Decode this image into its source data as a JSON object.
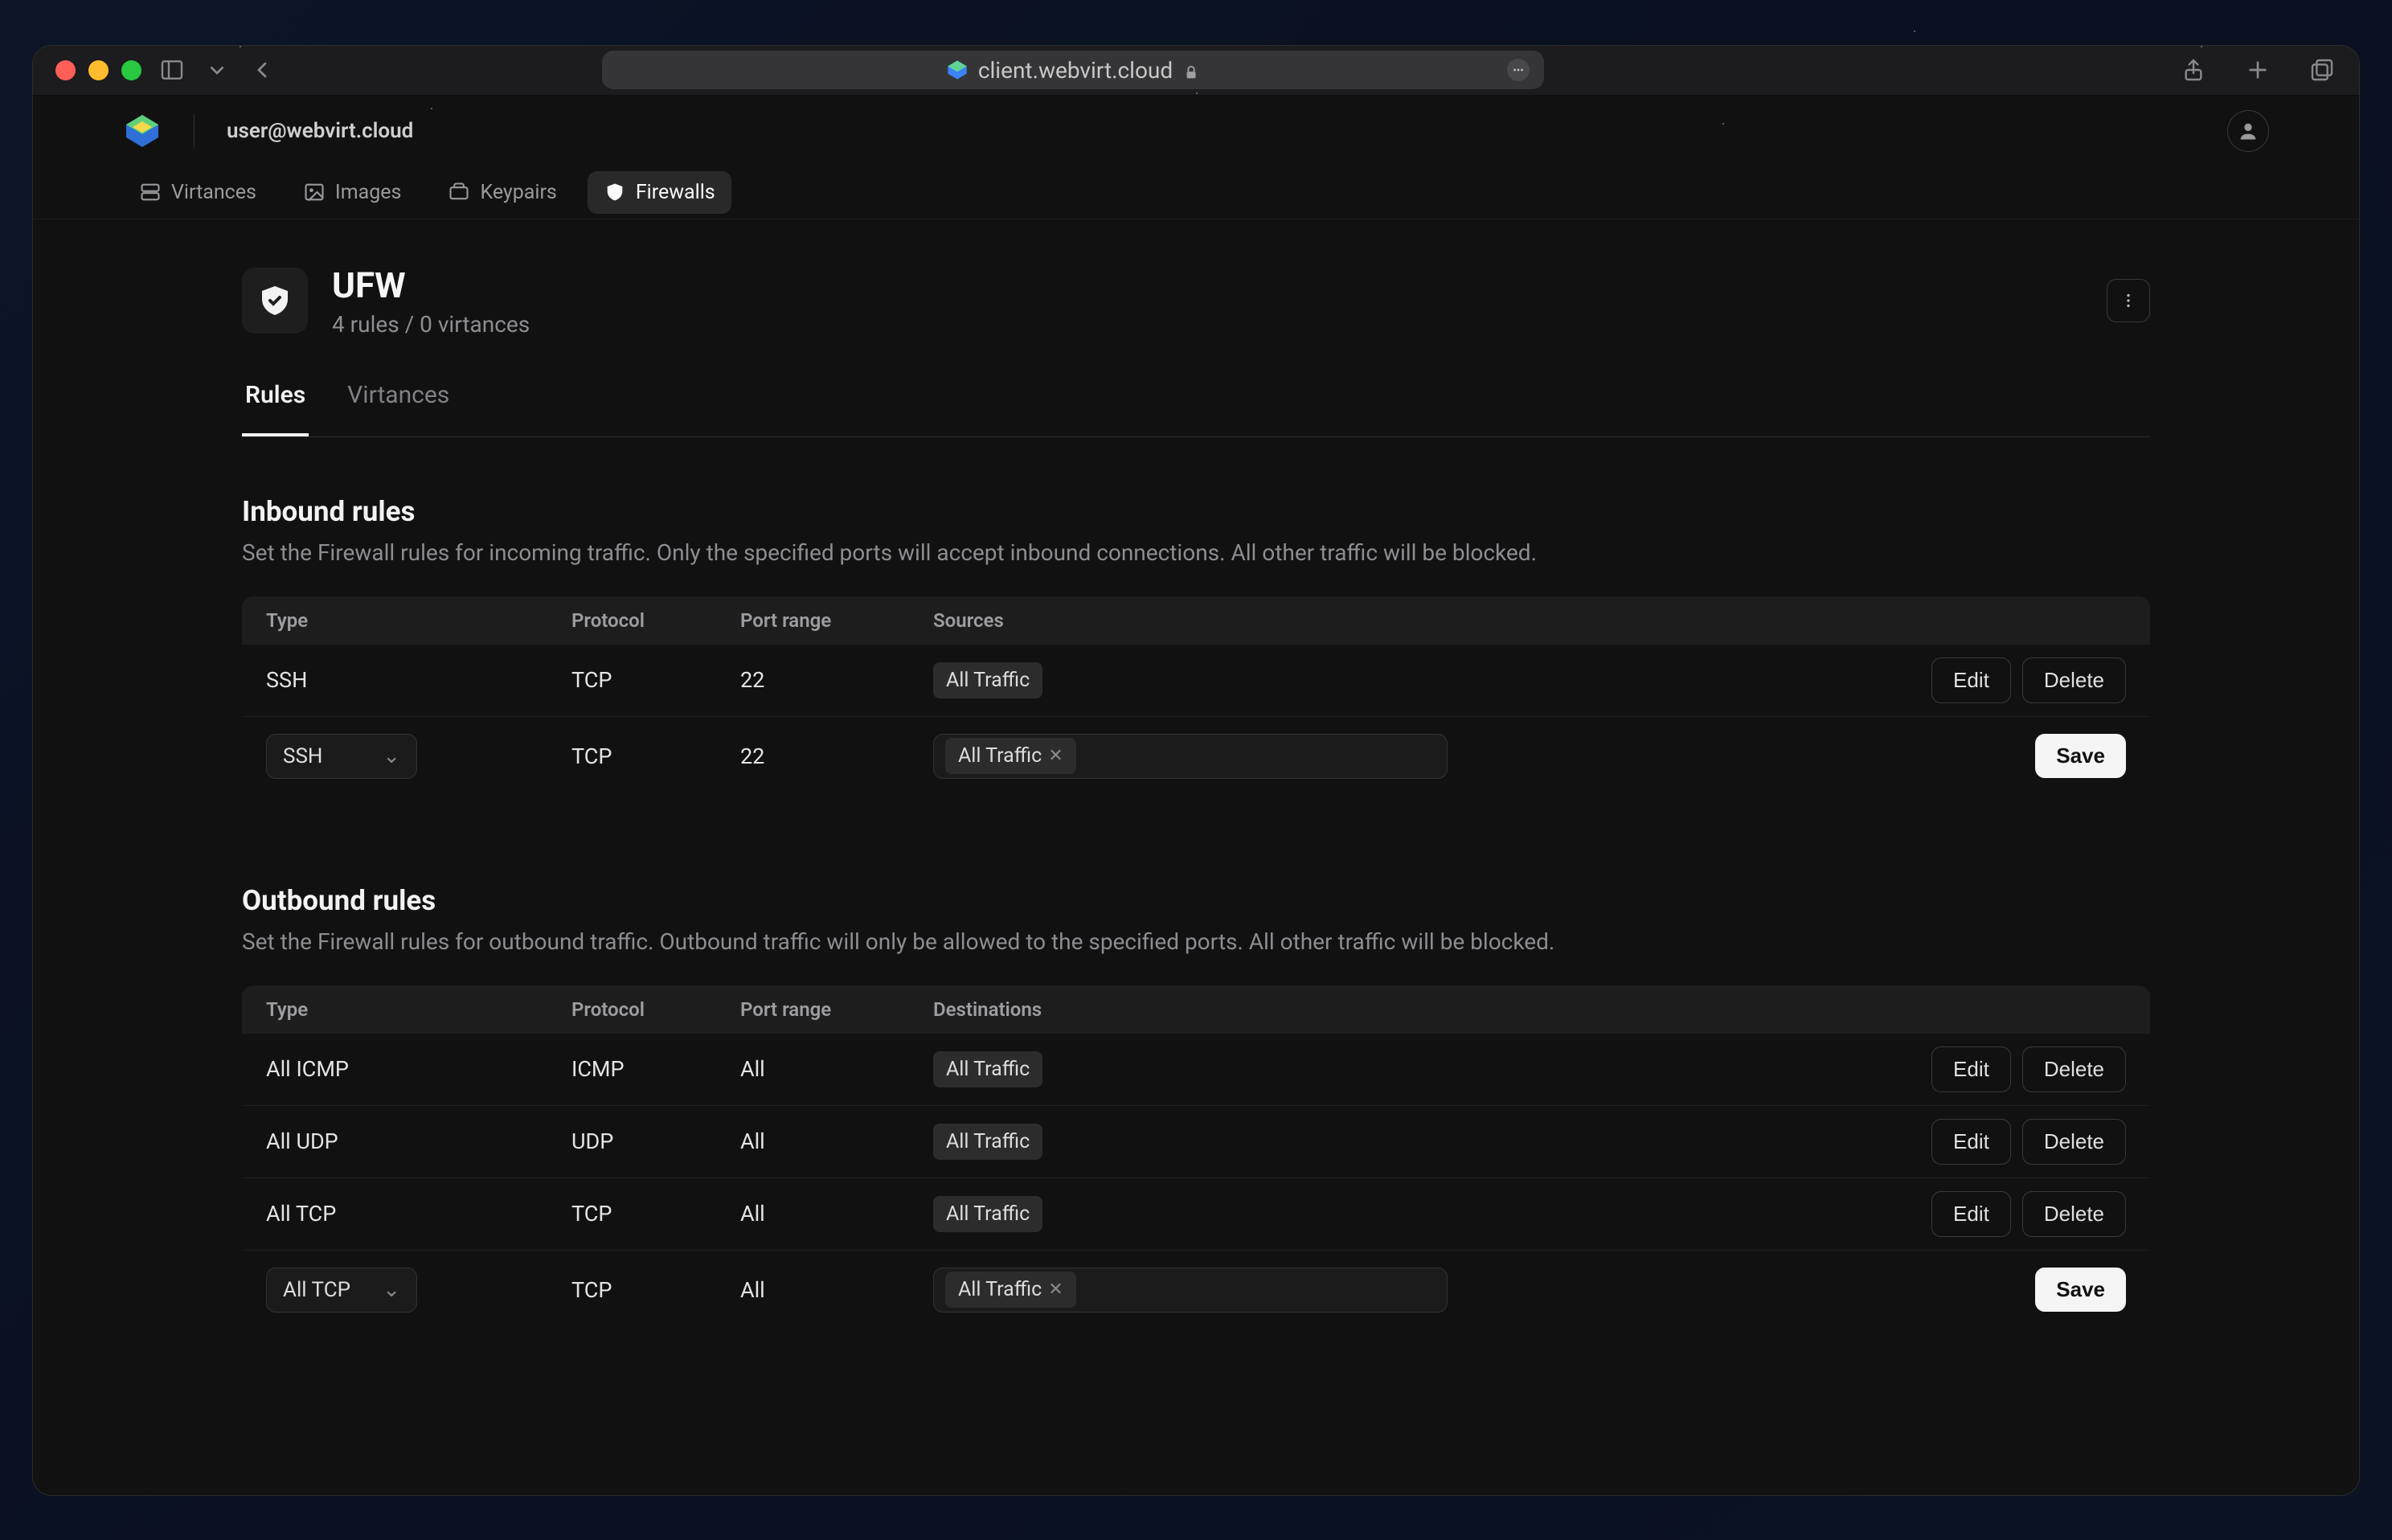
{
  "browser": {
    "url": "client.webvirt.cloud"
  },
  "header": {
    "user_email": "user@webvirt.cloud"
  },
  "nav": {
    "items": [
      {
        "label": "Virtances"
      },
      {
        "label": "Images"
      },
      {
        "label": "Keypairs"
      },
      {
        "label": "Firewalls"
      }
    ]
  },
  "firewall": {
    "name": "UFW",
    "summary": "4 rules / 0 virtances"
  },
  "tabs": {
    "rules": "Rules",
    "virtances": "Virtances"
  },
  "inbound": {
    "title": "Inbound rules",
    "description": "Set the Firewall rules for incoming traffic. Only the specified ports will accept inbound connections. All other traffic will be blocked.",
    "columns": {
      "type": "Type",
      "protocol": "Protocol",
      "port": "Port range",
      "sources": "Sources"
    },
    "rows": [
      {
        "type": "SSH",
        "protocol": "TCP",
        "port": "22",
        "source": "All Traffic"
      }
    ],
    "edit_row": {
      "type": "SSH",
      "protocol": "TCP",
      "port": "22",
      "source": "All Traffic"
    }
  },
  "outbound": {
    "title": "Outbound rules",
    "description": "Set the Firewall rules for outbound traffic. Outbound traffic will only be allowed to the specified ports. All other traffic will be blocked.",
    "columns": {
      "type": "Type",
      "protocol": "Protocol",
      "port": "Port range",
      "dest": "Destinations"
    },
    "rows": [
      {
        "type": "All ICMP",
        "protocol": "ICMP",
        "port": "All",
        "dest": "All Traffic"
      },
      {
        "type": "All UDP",
        "protocol": "UDP",
        "port": "All",
        "dest": "All Traffic"
      },
      {
        "type": "All TCP",
        "protocol": "TCP",
        "port": "All",
        "dest": "All Traffic"
      }
    ],
    "edit_row": {
      "type": "All TCP",
      "protocol": "TCP",
      "port": "All",
      "dest": "All Traffic"
    }
  },
  "buttons": {
    "edit": "Edit",
    "delete": "Delete",
    "save": "Save"
  }
}
